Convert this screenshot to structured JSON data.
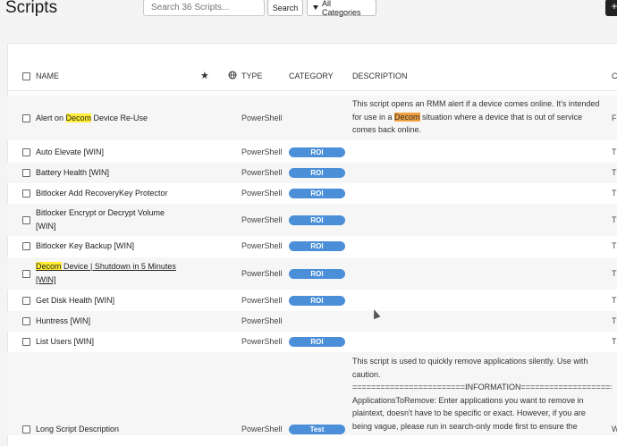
{
  "header": {
    "title": "Scripts",
    "search_placeholder": "Search 36 Scripts...",
    "search_button": "Search",
    "categories_button": "All Categories",
    "add_button": "+"
  },
  "table": {
    "columns": {
      "name": "NAME",
      "type": "TYPE",
      "category": "CATEGORY",
      "description": "DESCRIPTION",
      "more": "C"
    },
    "rows": [
      {
        "name_pre": "Alert on ",
        "name_hl": "Decom",
        "name_post": " Device Re-Use",
        "type": "PowerShell",
        "category": "",
        "desc_1": "This script opens an RMM alert if a device comes online. It's intended",
        "desc_2_pre": "for use in a ",
        "desc_2_hl": "Decom",
        "desc_2_post": " situation where a device that is out of service",
        "desc_3": "comes back online.",
        "edge": "F"
      },
      {
        "name": "Auto Elevate [WIN]",
        "type": "PowerShell",
        "category": "ROI",
        "edge": "T"
      },
      {
        "name": "Battery Health [WIN]",
        "type": "PowerShell",
        "category": "ROI",
        "edge": "T"
      },
      {
        "name": "Bitlocker Add RecoveryKey Protector",
        "type": "PowerShell",
        "category": "ROI",
        "edge": "T"
      },
      {
        "name_1": "Bitlocker Encrypt or Decrypt Volume",
        "name_2": "[WIN]",
        "type": "PowerShell",
        "category": "ROI",
        "edge": "T"
      },
      {
        "name": "Bitlocker Key Backup [WIN]",
        "type": "PowerShell",
        "category": "ROI",
        "edge": "T"
      },
      {
        "name_hl": "Decom",
        "name_post": " Device | Shutdown in 5 Minutes",
        "name_2": "[WIN]",
        "type": "PowerShell",
        "category": "ROI",
        "edge": "T"
      },
      {
        "name": "Get Disk Health [WIN]",
        "type": "PowerShell",
        "category": "ROI",
        "edge": "T"
      },
      {
        "name": "Huntress [WIN]",
        "type": "PowerShell",
        "category": "",
        "edge": "T"
      },
      {
        "name": "List Users [WIN]",
        "type": "PowerShell",
        "category": "ROI",
        "edge": "T"
      },
      {
        "name": "Long Script Description",
        "type": "PowerShell",
        "category": "Test",
        "desc_1": "This script is used to quickly remove applications silently. Use with",
        "desc_2": "caution.",
        "desc_3": "========================INFORMATION=======================",
        "desc_4": "ApplicationsToRemove: Enter applications you want to remove in",
        "desc_5": "plaintext, doesn't have to be specific or exact. However, if you are",
        "desc_6": "being vague, please run in search-only mode first to ensure the",
        "edge": "W"
      }
    ]
  },
  "colors": {
    "badge": "#4a8fd8",
    "highlight": "#ffee33",
    "highlight_alt": "#f0a040"
  }
}
